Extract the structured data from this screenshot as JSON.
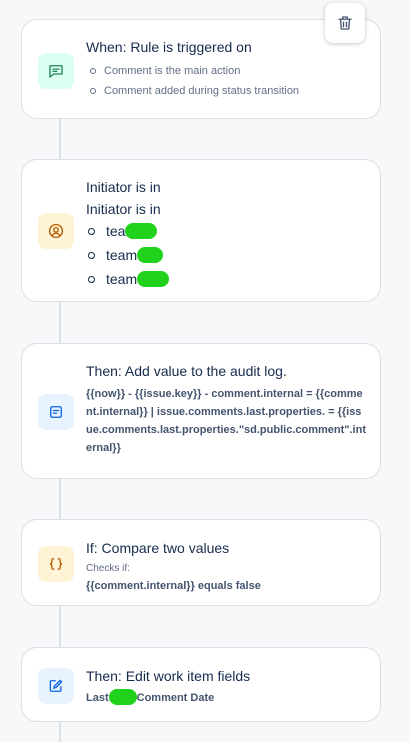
{
  "colors": {
    "trigger_bg": "#dcfff1",
    "trigger_fg": "#1f845a",
    "condition_bg": "#fff3d6",
    "condition_fg": "#b65c02",
    "action_bg": "#e9f2ff",
    "action_fg": "#0c66e4",
    "redaction": "#22d11c"
  },
  "delete_button": {
    "icon": "trash-icon"
  },
  "trigger": {
    "icon": "comment-icon",
    "title": "When: Rule is triggered on",
    "items": [
      "Comment is the main action",
      "Comment added during status transition"
    ]
  },
  "initiator": {
    "icon": "user-circle-icon",
    "title": "Initiator is in",
    "subtitle": "Initiator is in",
    "teams": [
      "tea",
      "team",
      "team"
    ]
  },
  "audit": {
    "icon": "audit-log-icon",
    "title": "Then: Add value to the audit log.",
    "detail": "{{now}} - {{issue.key}} - comment.internal = {{comment.internal}} | issue.comments.last.properties. = {{issue.comments.last.properties.\"sd.public.comment\".internal}}"
  },
  "compare": {
    "icon": "braces-icon",
    "title": "If: Compare two values",
    "checks_label": "Checks if:",
    "detail": "{{comment.internal}} equals false"
  },
  "edit": {
    "icon": "edit-icon",
    "title": "Then: Edit work item fields",
    "detail_prefix": "Last",
    "detail_suffix": "Comment Date"
  }
}
